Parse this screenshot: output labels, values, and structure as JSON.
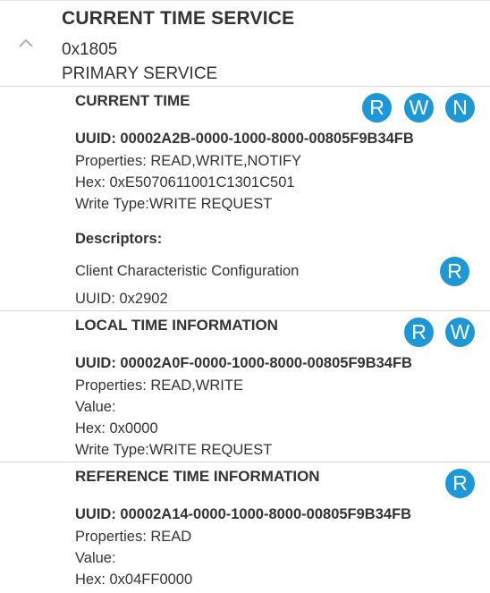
{
  "service": {
    "name": "CURRENT TIME SERVICE",
    "uuid": "0x1805",
    "type": "PRIMARY SERVICE"
  },
  "characteristics": [
    {
      "name": "CURRENT TIME",
      "uuid": "UUID: 00002A2B-0000-1000-8000-00805F9B34FB",
      "properties": "Properties: READ,WRITE,NOTIFY",
      "hex": "Hex: 0xE5070611001C1301C501",
      "write_type": "Write Type:WRITE REQUEST",
      "buttons": [
        "R",
        "W",
        "N"
      ],
      "descriptors_label": "Descriptors:",
      "descriptor": {
        "name": "Client Characteristic Configuration",
        "uuid": "UUID: 0x2902",
        "button": "R"
      }
    },
    {
      "name": "LOCAL TIME INFORMATION",
      "uuid": "UUID: 00002A0F-0000-1000-8000-00805F9B34FB",
      "properties": "Properties: READ,WRITE",
      "value_label": "Value:",
      "hex": "Hex: 0x0000",
      "write_type": "Write Type:WRITE REQUEST",
      "buttons": [
        "R",
        "W"
      ]
    },
    {
      "name": "REFERENCE TIME INFORMATION",
      "uuid": "UUID: 00002A14-0000-1000-8000-00805F9B34FB",
      "properties": "Properties: READ",
      "value_label": "Value:",
      "hex": "Hex: 0x04FF0000",
      "buttons": [
        "R"
      ]
    }
  ],
  "colors": {
    "accent": "#1e97d6",
    "divider": "#d6d6d6",
    "text": "#333333"
  },
  "icons": {
    "collapse": "chevron-up-icon"
  }
}
